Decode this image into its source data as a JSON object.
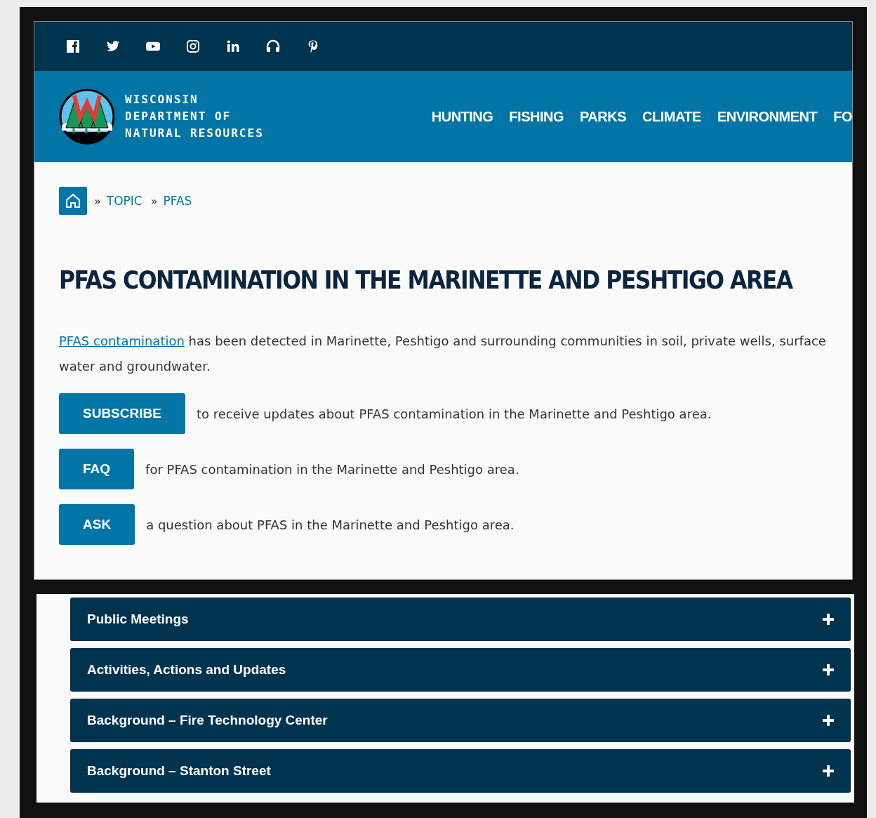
{
  "social_links": [
    {
      "kind": "facebook"
    },
    {
      "kind": "twitter"
    },
    {
      "kind": "youtube"
    },
    {
      "kind": "instagram"
    },
    {
      "kind": "linkedin"
    },
    {
      "kind": "podcast"
    },
    {
      "kind": "pinterest"
    }
  ],
  "header": {
    "logo_lines": [
      "WISCONSIN",
      "DEPARTMENT OF",
      "NATURAL RESOURCES"
    ],
    "nav": [
      "HUNTING",
      "FISHING",
      "PARKS",
      "CLIMATE",
      "ENVIRONMENT",
      "FO"
    ]
  },
  "breadcrumb": {
    "separator": "»",
    "items": [
      "TOPIC",
      "PFAS"
    ]
  },
  "title": "PFAS CONTAMINATION IN THE MARINETTE AND PESHTIGO AREA",
  "intro": {
    "link": "PFAS contamination",
    "text": " has been detected in Marinette, Peshtigo and surrounding communities in soil, private wells, surface water and groundwater."
  },
  "actions": [
    {
      "button": "SUBSCRIBE",
      "text": "to receive updates about PFAS contamination in the Marinette and Peshtigo area."
    },
    {
      "button": "FAQ",
      "text": "for PFAS contamination in the Marinette and Peshtigo area."
    },
    {
      "button": "ASK",
      "text": "a question about PFAS in the Marinette and Peshtigo area."
    }
  ],
  "accordion": [
    {
      "label": "Public Meetings",
      "expanded": false
    },
    {
      "label": "Activities, Actions and Updates",
      "expanded": false
    },
    {
      "label": "Background – Fire Technology Center",
      "expanded": false
    },
    {
      "label": "Background – Stanton Street",
      "expanded": false
    }
  ]
}
